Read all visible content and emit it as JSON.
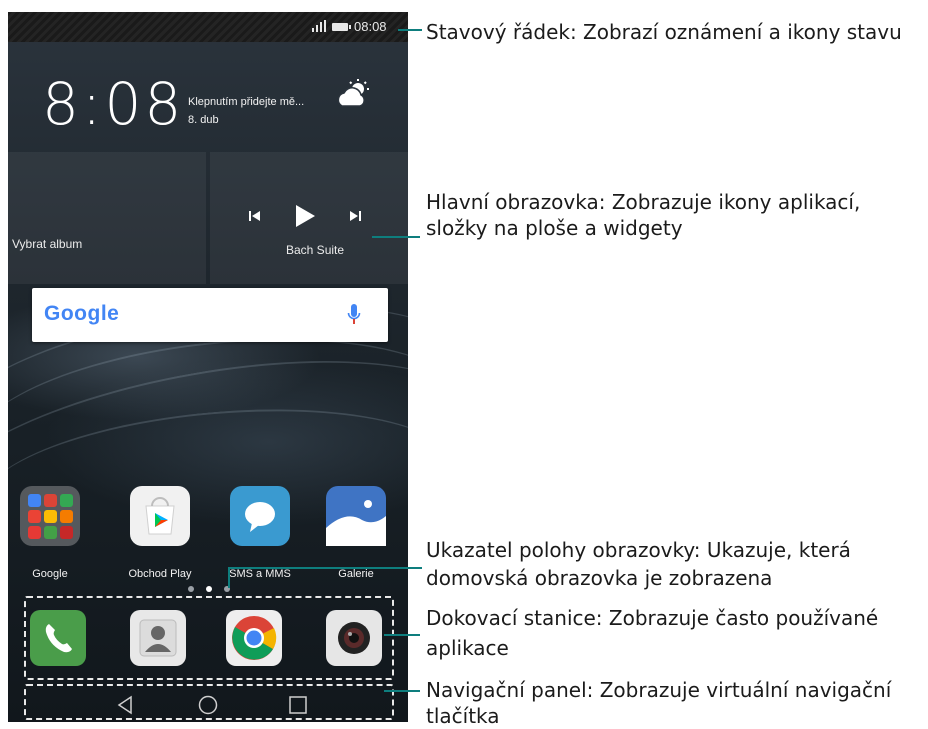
{
  "status_bar": {
    "time": "08:08"
  },
  "clock_widget": {
    "time": "8:08",
    "weather_prompt": "Klepnutím přidejte mě...",
    "date": "8. dub"
  },
  "music_widget": {
    "album_label": "Vybrat album",
    "track_title": "Bach Suite"
  },
  "search_bar": {
    "logo": "Google",
    "mic_icon": "mic-icon"
  },
  "apps": [
    {
      "label": "Google",
      "icon": "google-folder-icon"
    },
    {
      "label": "Obchod Play",
      "icon": "play-store-icon"
    },
    {
      "label": "SMS a MMS",
      "icon": "messaging-icon"
    },
    {
      "label": "Galerie",
      "icon": "gallery-icon"
    }
  ],
  "page_indicator": {
    "pages": 3,
    "current": 2
  },
  "dock": [
    {
      "icon": "phone-icon"
    },
    {
      "icon": "contacts-icon"
    },
    {
      "icon": "chrome-icon"
    },
    {
      "icon": "camera-icon"
    }
  ],
  "nav_bar": [
    "back-icon",
    "home-icon",
    "recents-icon"
  ],
  "callouts": {
    "status_bar": "Stavový řádek: Zobrazí oznámení a ikony stavu",
    "home_line1": "Hlavní obrazovka: Zobrazuje ikony aplikací,",
    "home_line2": "složky na ploše a widgety",
    "indicator_line1": "Ukazatel polohy obrazovky: Ukazuje, která",
    "indicator_line2": "domovská obrazovka je zobrazena",
    "dock_line1": "Dokovací stanice: Zobrazuje často používané",
    "dock_line2": "aplikace",
    "nav_line1": "Navigační panel: Zobrazuje virtuální navigační",
    "nav_line2": "tlačítka"
  },
  "colors": {
    "leader_line": "#0e7e7e",
    "dashed_frame": "#e9e9e9"
  }
}
